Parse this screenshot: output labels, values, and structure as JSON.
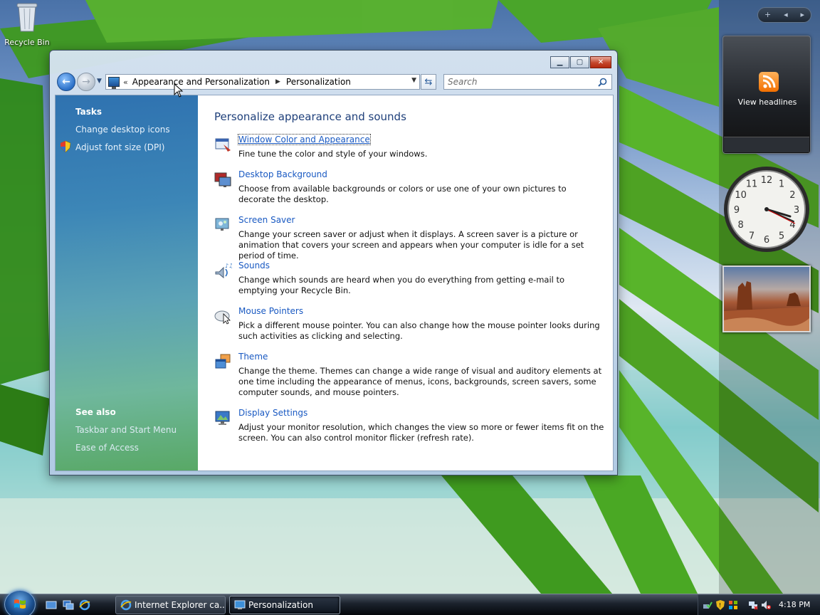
{
  "desktop": {
    "recycle_bin_label": "Recycle Bin"
  },
  "sidebar": {
    "feed_gadget_label": "View headlines",
    "clock_numerals": [
      "12",
      "1",
      "2",
      "3",
      "4",
      "5",
      "6",
      "7",
      "8",
      "9",
      "10",
      "11"
    ],
    "gadget_bar_plus": "+",
    "gadget_bar_prev": "◂",
    "gadget_bar_next": "▸"
  },
  "window": {
    "breadcrumb": [
      "Appearance and Personalization",
      "Personalization"
    ],
    "breadcrumb_overflow": "«",
    "search_placeholder": "Search",
    "caption": {
      "minimize": "▁",
      "maximize": "▢",
      "close": "✕"
    }
  },
  "tasks": {
    "title": "Tasks",
    "items": [
      "Change desktop icons",
      "Adjust font size (DPI)"
    ]
  },
  "see_also": {
    "title": "See also",
    "items": [
      "Taskbar and Start Menu",
      "Ease of Access"
    ]
  },
  "main": {
    "title": "Personalize appearance and sounds",
    "items": [
      {
        "label": "Window Color and Appearance",
        "icon": "window-color-icon",
        "description": "Fine tune the color and style of your windows."
      },
      {
        "label": "Desktop Background",
        "icon": "desktop-background-icon",
        "description": "Choose from available backgrounds or colors or use one of your own pictures to decorate the desktop."
      },
      {
        "label": "Screen Saver",
        "icon": "screen-saver-icon",
        "description": "Change your screen saver or adjust when it displays. A screen saver is a picture or animation that covers your screen and appears when your computer is idle for a set period of time."
      },
      {
        "label": "Sounds",
        "icon": "sounds-icon",
        "description": "Change which sounds are heard when you do everything from getting e-mail to emptying your Recycle Bin."
      },
      {
        "label": "Mouse Pointers",
        "icon": "mouse-pointers-icon",
        "description": "Pick a different mouse pointer. You can also change how the mouse pointer looks during such activities as clicking and selecting."
      },
      {
        "label": "Theme",
        "icon": "theme-icon",
        "description": "Change the theme. Themes can change a wide range of visual and auditory elements at one time including the appearance of menus, icons, backgrounds, screen savers, some computer sounds, and mouse pointers."
      },
      {
        "label": "Display Settings",
        "icon": "display-settings-icon",
        "description": "Adjust your monitor resolution, which changes the view so more or fewer items fit on the screen. You can also control monitor flicker (refresh rate)."
      }
    ]
  },
  "taskbar": {
    "buttons": [
      {
        "label": "Internet Explorer ca...",
        "active": false
      },
      {
        "label": "Personalization",
        "active": true
      }
    ],
    "clock": "4:18 PM"
  },
  "colors": {
    "link": "#1959c2",
    "title": "#1e3f7a",
    "left_pane_top": "#2f72b0",
    "left_pane_bottom": "#58a865"
  }
}
